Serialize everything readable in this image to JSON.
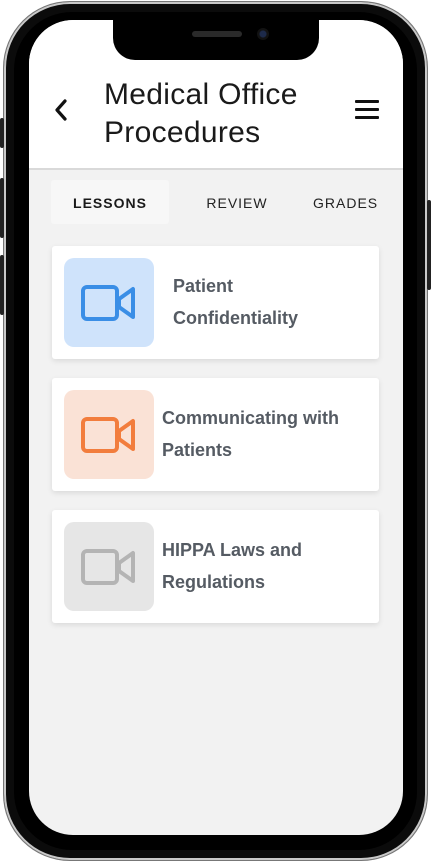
{
  "header": {
    "title_line1": "Medical Office",
    "title_line2": "Procedures"
  },
  "icons": {
    "back": "chevron-left-icon",
    "menu": "hamburger-menu-icon",
    "lesson": "video-camera-icon"
  },
  "tabs": [
    {
      "label": "LESSONS",
      "active": true
    },
    {
      "label": "REVIEW",
      "active": false
    },
    {
      "label": "GRADES",
      "active": false
    }
  ],
  "lessons": [
    {
      "line1": "Patient",
      "line2": "Confidentiality",
      "icon_color": "#3a8ee6",
      "thumb_bg": "#cfe3fb"
    },
    {
      "line1": "Communicating with",
      "line2": "Patients",
      "icon_color": "#f27d3d",
      "thumb_bg": "#fae2d6"
    },
    {
      "line1": "HIPPA Laws and",
      "line2": "Regulations",
      "icon_color": "#b4b4b4",
      "thumb_bg": "#e6e6e6"
    }
  ]
}
